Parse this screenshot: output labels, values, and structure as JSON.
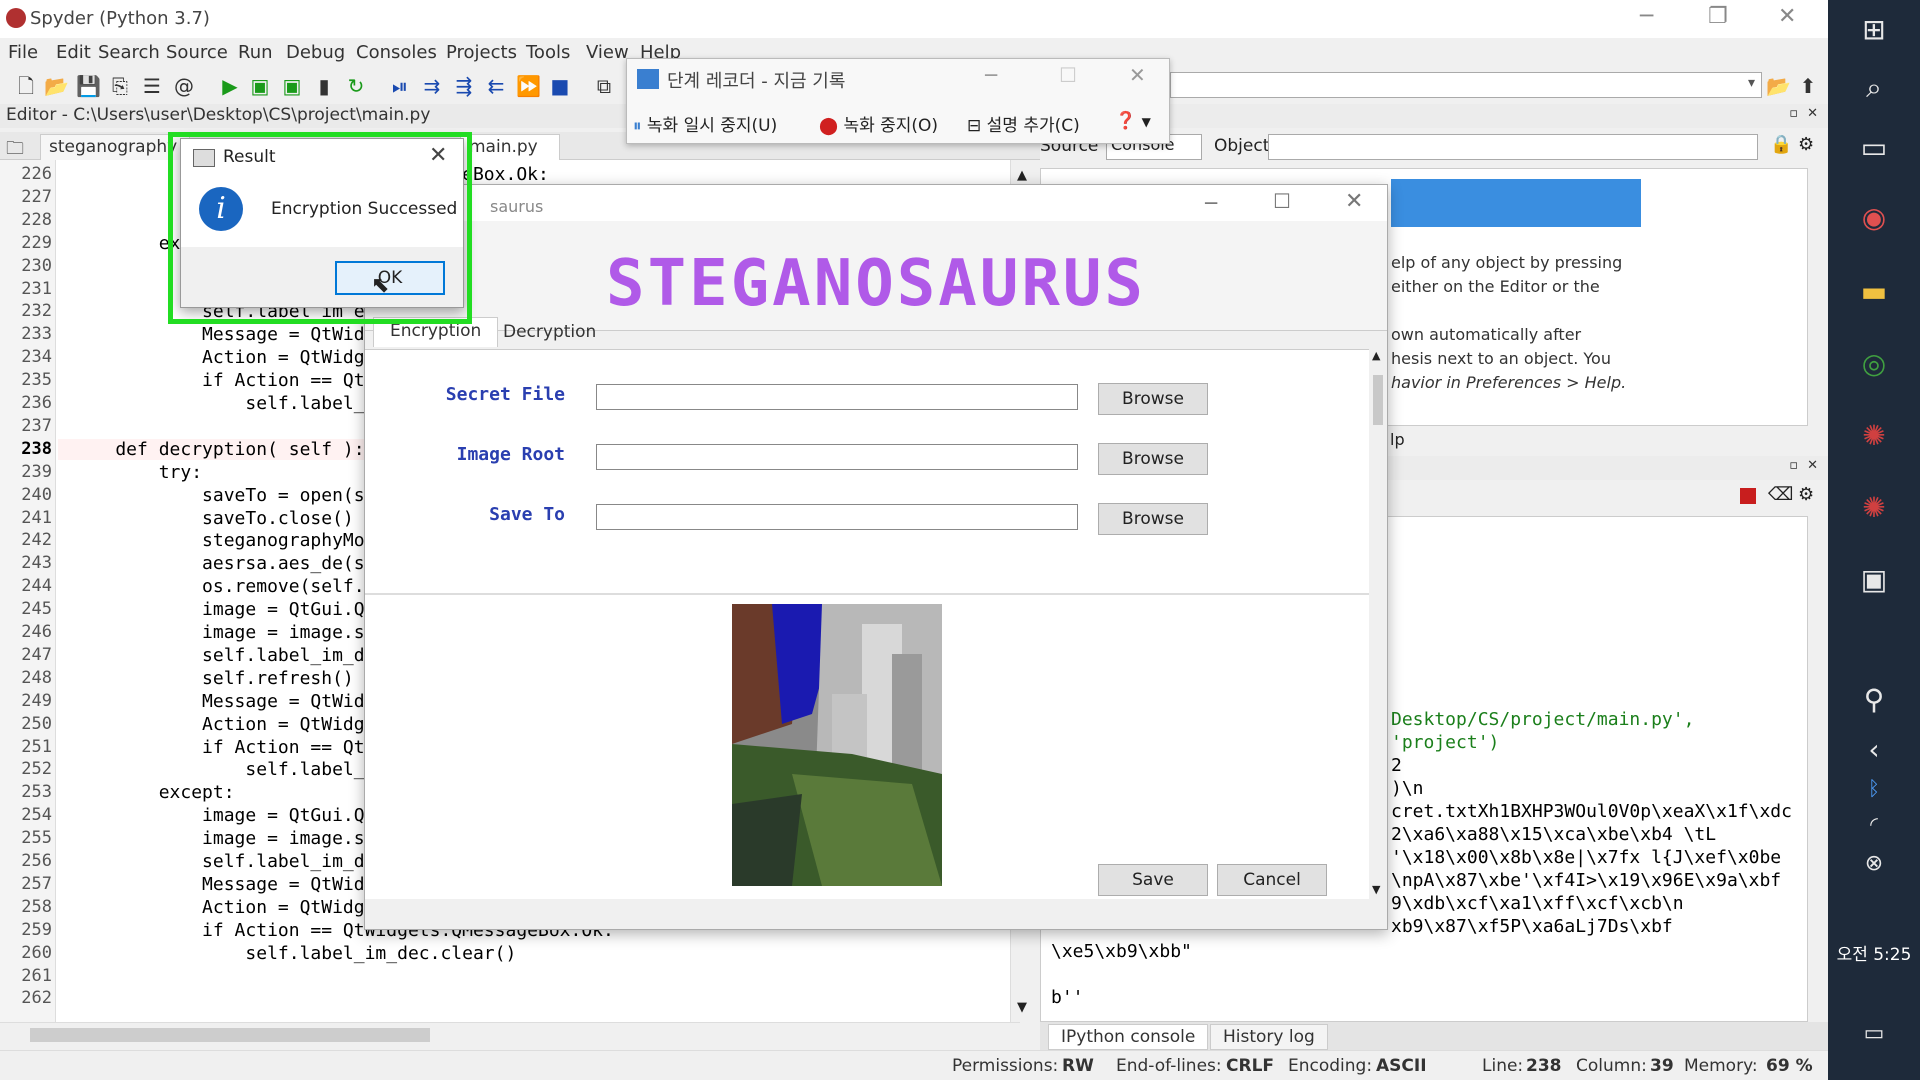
{
  "window": {
    "title": "Spyder (Python 3.7)"
  },
  "menu": [
    "File",
    "Edit",
    "Search",
    "Source",
    "Run",
    "Debug",
    "Consoles",
    "Projects",
    "Tools",
    "View",
    "Help"
  ],
  "editor": {
    "path": "Editor - C:\\Users\\user\\Desktop\\CS\\project\\main.py",
    "tabs": [
      "steganography",
      "main.py"
    ],
    "lines": [
      {
        "n": "226",
        "code": "                               essageBox.Ok:"
      },
      {
        "n": "227",
        "code": ""
      },
      {
        "n": "228",
        "code": ""
      },
      {
        "n": "229",
        "code": "        exc"
      },
      {
        "n": "230",
        "code": ""
      },
      {
        "n": "231",
        "code": ""
      },
      {
        "n": "232",
        "code": "            self.label_im_en"
      },
      {
        "n": "233",
        "code": "            Message = QtWidg"
      },
      {
        "n": "234",
        "code": "            Action = QtWidge"
      },
      {
        "n": "235",
        "code": "            if Action == QtW"
      },
      {
        "n": "236",
        "code": "                self.label_i"
      },
      {
        "n": "237",
        "code": ""
      },
      {
        "n": "238",
        "code": "    def decryption( self ):"
      },
      {
        "n": "239",
        "code": "        try:"
      },
      {
        "n": "240",
        "code": "            saveTo = open(se"
      },
      {
        "n": "241",
        "code": "            saveTo.close()"
      },
      {
        "n": "242",
        "code": "            steganographyMod"
      },
      {
        "n": "243",
        "code": "            aesrsa.aes_de(se"
      },
      {
        "n": "244",
        "code": "            os.remove(self.l"
      },
      {
        "n": "245",
        "code": "            image = QtGui.QP"
      },
      {
        "n": "246",
        "code": "            image = image.sc"
      },
      {
        "n": "247",
        "code": "            self.label_im_de"
      },
      {
        "n": "248",
        "code": "            self.refresh()"
      },
      {
        "n": "249",
        "code": "            Message = QtWidg"
      },
      {
        "n": "250",
        "code": "            Action = QtWidge"
      },
      {
        "n": "251",
        "code": "            if Action == QtW"
      },
      {
        "n": "252",
        "code": "                self.label_i"
      },
      {
        "n": "253",
        "code": "        except:"
      },
      {
        "n": "254",
        "code": "            image = QtGui.QP"
      },
      {
        "n": "255",
        "code": "            image = image.sc"
      },
      {
        "n": "256",
        "code": "            self.label_im_de"
      },
      {
        "n": "257",
        "code": "            Message = QtWidg"
      },
      {
        "n": "258",
        "code": "            Action = QtWidge"
      },
      {
        "n": "259",
        "code": "            if Action == QtWidgets.QMessageBox.Ok:"
      },
      {
        "n": "260",
        "code": "                self.label_im_dec.clear()"
      },
      {
        "n": "261",
        "code": ""
      },
      {
        "n": "262",
        "code": ""
      }
    ]
  },
  "right": {
    "source_label": "Source",
    "source_value": "Console",
    "object_label": "Object",
    "help_lines": [
      "elp of any object by pressing",
      "either on the Editor or the",
      "",
      "own automatically after",
      "hesis next to an object. You",
      "havior in Preferences > Help."
    ],
    "help_tab": "lp",
    "console_lines": [
      {
        "t": "Desktop/CS/project/main.py',",
        "str": true
      },
      {
        "t": "'project')",
        "str": true
      },
      {
        "t": "2",
        "str": false
      },
      {
        "t": ")\\n",
        "str": false
      },
      {
        "t": "cret.txtXh1BXHP3WOul0V0p\\xeaX\\x1f\\xdc",
        "str": false
      },
      {
        "t": "2\\xa6\\xa88\\x15\\xca\\xbe\\xb4 \\tL",
        "str": false
      },
      {
        "t": "'\\x18\\x00\\x8b\\x8e|\\x7fx l{J\\xef\\x0be",
        "str": false
      },
      {
        "t": "\\npA\\x87\\xbe'\\xf4I>\\x19\\x96E\\x9a\\xbf",
        "str": false
      },
      {
        "t": "9\\xdb\\xcf\\xa1\\xff\\xcf\\xcb\\n",
        "str": false
      },
      {
        "t": "xb9\\x87\\xf5P\\xa6aLj7Ds\\xbf",
        "str": false
      }
    ],
    "console_tail": [
      "\\xe5\\xb9\\xbb\"",
      "",
      "b''"
    ],
    "console_tabs": [
      "IPython console",
      "History log"
    ]
  },
  "status": {
    "permissions_label": "Permissions:",
    "permissions": "RW",
    "eol_label": "End-of-lines:",
    "eol": "CRLF",
    "encoding_label": "Encoding:",
    "encoding": "ASCII",
    "line_label": "Line:",
    "line": "238",
    "column_label": "Column:",
    "column": "39",
    "memory_label": "Memory:",
    "memory": "69 %"
  },
  "recorder": {
    "title": "단계 레코더 - 지금 기록",
    "pause": "녹화 일시 중지(U)",
    "stop": "녹화 중지(O)",
    "comment": "설명 추가(C)"
  },
  "steg": {
    "title": "saurus",
    "logo": "STEGANOSAURUS",
    "tabs": [
      "Encryption",
      "Decryption"
    ],
    "fields": [
      {
        "label": "Secret File",
        "value": ""
      },
      {
        "label": "Image Root",
        "value": ""
      },
      {
        "label": "Save To",
        "value": ""
      }
    ],
    "browse": "Browse",
    "save": "Save",
    "cancel": "Cancel"
  },
  "dialog": {
    "title": "Result",
    "message": "Encryption Successed",
    "ok": "OK"
  },
  "taskbar": {
    "clock": "오전 5:25"
  },
  "colors": {
    "logo": "#b05ae8",
    "label": "#2a3fb0",
    "highlight": "#22dd22",
    "info": "#1a66c0"
  }
}
